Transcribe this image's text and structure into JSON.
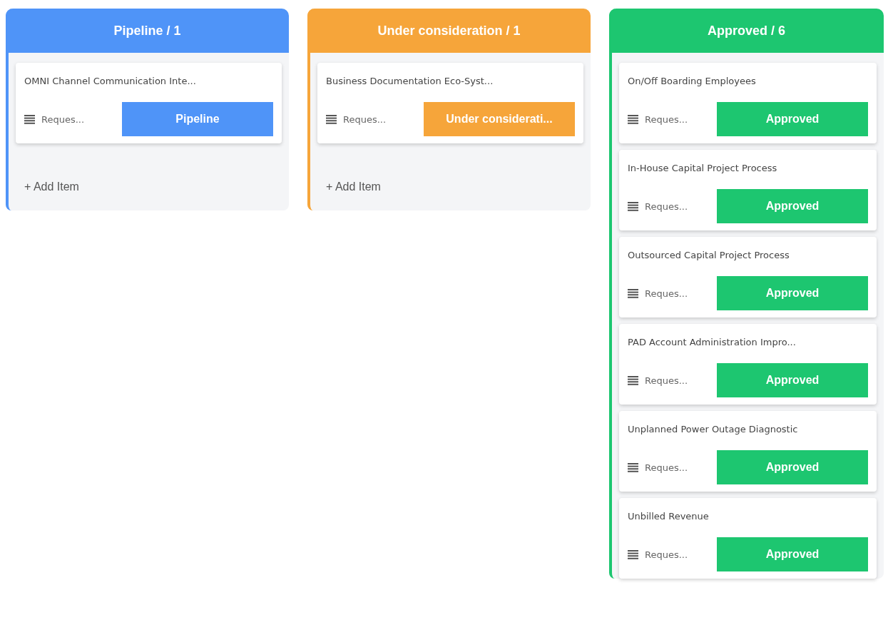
{
  "columns": [
    {
      "title": "Pipeline / 1",
      "color": "#4f94f8",
      "cards": [
        {
          "title": "OMNI Channel Communication Inte...",
          "meta": "Reques...",
          "status": "Pipeline"
        }
      ],
      "add_item": "+ Add Item"
    },
    {
      "title": "Under consideration / 1",
      "color": "#f6a53a",
      "cards": [
        {
          "title": "Business Documentation Eco-Syst...",
          "meta": "Reques...",
          "status": "Under considerati..."
        }
      ],
      "add_item": "+ Add Item"
    },
    {
      "title": "Approved / 6",
      "color": "#1dc670",
      "cards": [
        {
          "title": "On/Off Boarding Employees",
          "meta": "Reques...",
          "status": "Approved"
        },
        {
          "title": "In-House Capital Project Process",
          "meta": "Reques...",
          "status": "Approved"
        },
        {
          "title": "Outsourced Capital Project Process",
          "meta": "Reques...",
          "status": "Approved"
        },
        {
          "title": "PAD Account Administration Impro...",
          "meta": "Reques...",
          "status": "Approved"
        },
        {
          "title": "Unplanned Power Outage Diagnostic",
          "meta": "Reques...",
          "status": "Approved"
        },
        {
          "title": "Unbilled Revenue",
          "meta": "Reques...",
          "status": "Approved"
        }
      ]
    }
  ]
}
